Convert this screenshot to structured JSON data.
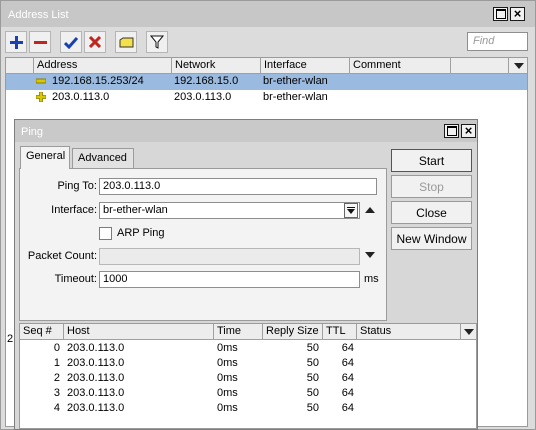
{
  "address_list": {
    "title": "Address List",
    "find_placeholder": "Find",
    "toolbar_icons": [
      "add-icon",
      "remove-icon",
      "enable-check-icon",
      "disable-x-icon",
      "comment-icon",
      "filter-icon"
    ],
    "columns": [
      "Address",
      "Network",
      "Interface",
      "Comment"
    ],
    "rows": [
      {
        "address": "192.168.15.253/24",
        "network": "192.168.15.0",
        "interface": "br-ether-wlan",
        "comment": ""
      },
      {
        "address": "203.0.113.0",
        "network": "203.0.113.0",
        "interface": "br-ether-wlan",
        "comment": ""
      }
    ],
    "status_count": "2"
  },
  "ping": {
    "title": "Ping",
    "tabs": [
      "General",
      "Advanced"
    ],
    "form": {
      "ping_to_label": "Ping To:",
      "ping_to_value": "203.0.113.0",
      "interface_label": "Interface:",
      "interface_value": "br-ether-wlan",
      "arp_ping_label": "ARP Ping",
      "packet_count_label": "Packet Count:",
      "packet_count_value": "",
      "timeout_label": "Timeout:",
      "timeout_value": "1000",
      "timeout_unit": "ms"
    },
    "buttons": {
      "start": "Start",
      "stop": "Stop",
      "close": "Close",
      "new_window": "New Window"
    },
    "results": {
      "columns": [
        "Seq #",
        "Host",
        "Time",
        "Reply Size",
        "TTL",
        "Status"
      ],
      "rows": [
        {
          "seq": "0",
          "host": "203.0.113.0",
          "time": "0ms",
          "size": "50",
          "ttl": "64",
          "status": ""
        },
        {
          "seq": "1",
          "host": "203.0.113.0",
          "time": "0ms",
          "size": "50",
          "ttl": "64",
          "status": ""
        },
        {
          "seq": "2",
          "host": "203.0.113.0",
          "time": "0ms",
          "size": "50",
          "ttl": "64",
          "status": ""
        },
        {
          "seq": "3",
          "host": "203.0.113.0",
          "time": "0ms",
          "size": "50",
          "ttl": "64",
          "status": ""
        },
        {
          "seq": "4",
          "host": "203.0.113.0",
          "time": "0ms",
          "size": "50",
          "ttl": "64",
          "status": ""
        }
      ]
    }
  },
  "colors": {
    "selection": "#9bbadf",
    "add_blue": "#1a3fb0",
    "remove_red": "#c0261f",
    "dynamic_icon_yellow": "#d8c800"
  }
}
